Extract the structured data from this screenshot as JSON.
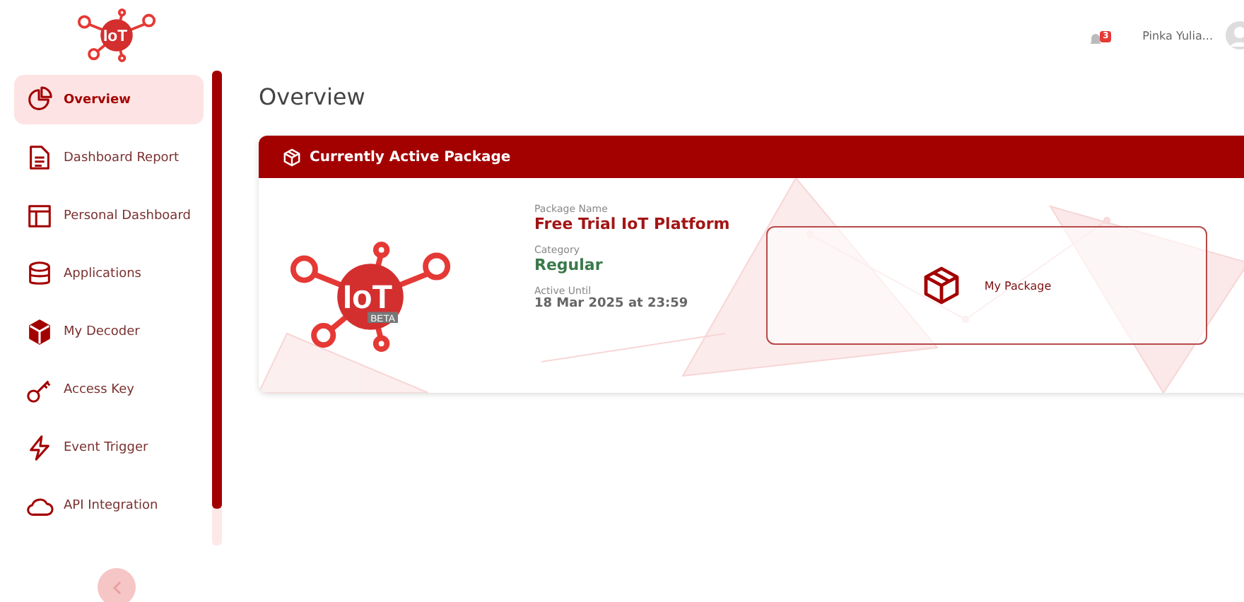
{
  "header": {
    "logo_text": "IoT",
    "notification_count": "3",
    "user_name": "Pinka Yulia..."
  },
  "sidebar": {
    "items": [
      {
        "label": "Overview",
        "selected": true
      },
      {
        "label": "Dashboard Report",
        "selected": false
      },
      {
        "label": "Personal Dashboard",
        "selected": false
      },
      {
        "label": "Applications",
        "selected": false
      },
      {
        "label": "My Decoder",
        "selected": false
      },
      {
        "label": "Access Key",
        "selected": false
      },
      {
        "label": "Event Trigger",
        "selected": false
      },
      {
        "label": "API Integration",
        "selected": false
      }
    ]
  },
  "page": {
    "title": "Overview"
  },
  "package_card": {
    "title": "Currently Active Package",
    "fields": [
      {
        "label": "Package Name",
        "value": "Free Trial IoT Platform",
        "kind": "name"
      },
      {
        "label": "Category",
        "value": "Regular",
        "kind": "category"
      },
      {
        "label": "Active Until",
        "value": "18 Mar 2025 at 23:59",
        "kind": "date"
      }
    ],
    "logo_badge": "BETA",
    "logo_text": "IoT",
    "action": "My Package"
  }
}
